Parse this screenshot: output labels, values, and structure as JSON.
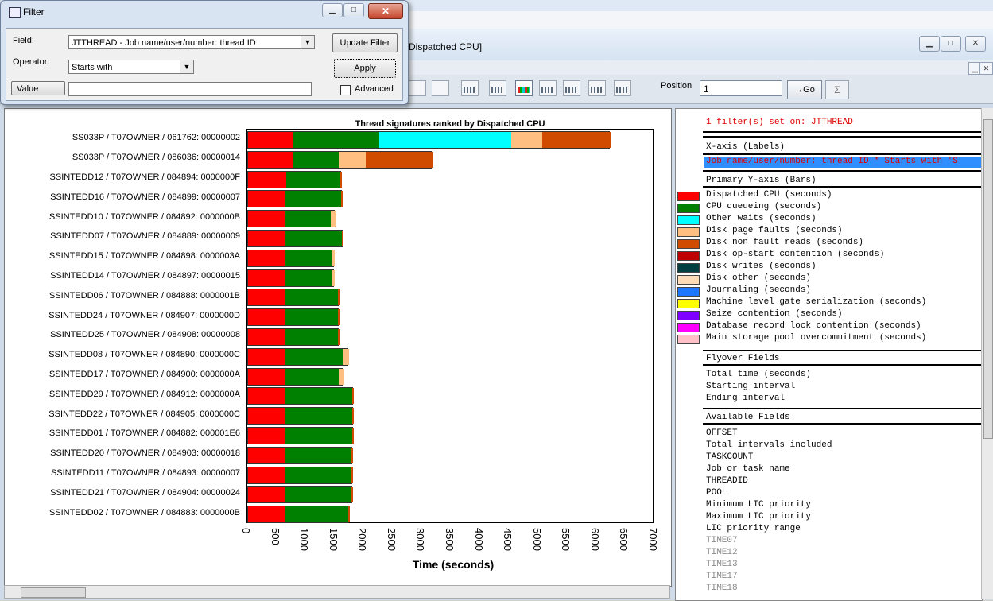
{
  "filter_dialog": {
    "title": "Filter",
    "field_label": "Field:",
    "field_value": "JTTHREAD - Job name/user/number: thread ID",
    "operator_label": "Operator:",
    "operator_value": "Starts with",
    "value_label": "Value",
    "value_input": "",
    "update_filter_label": "Update Filter",
    "apply_label": "Apply",
    "advanced_label": "Advanced",
    "advanced_checked": false
  },
  "main_window": {
    "title": "Dispatched CPU]"
  },
  "toolbar": {
    "position_label": "Position",
    "position_value": "1",
    "go_label": "→Go",
    "sigma_label": "Σ"
  },
  "chart_data": {
    "type": "bar",
    "orientation": "horizontal",
    "stacked": true,
    "title": "Thread signatures ranked by Dispatched CPU",
    "xlabel": "Time (seconds)",
    "ylabel": "",
    "xlim": [
      0,
      7000
    ],
    "xticks": [
      "0",
      "500",
      "1000",
      "1500",
      "2000",
      "2500",
      "3000",
      "3500",
      "4000",
      "4500",
      "5000",
      "5500",
      "6000",
      "6500",
      "7000"
    ],
    "categories": [
      "SS033P / T07OWNER / 061762: 00000002",
      "SS033P / T07OWNER / 086036: 00000014",
      "SSINTEDD12 / T07OWNER / 084894: 0000000F",
      "SSINTEDD16 / T07OWNER / 084899: 00000007",
      "SSINTEDD10 / T07OWNER / 084892: 0000000B",
      "SSINTEDD07 / T07OWNER / 084889: 00000009",
      "SSINTEDD15 / T07OWNER / 084898: 0000003A",
      "SSINTEDD14 / T07OWNER / 084897: 00000015",
      "SSINTEDD06 / T07OWNER / 084888: 0000001B",
      "SSINTEDD24 / T07OWNER / 084907: 0000000D",
      "SSINTEDD25 / T07OWNER / 084908: 00000008",
      "SSINTEDD08 / T07OWNER / 084890: 0000000C",
      "SSINTEDD17 / T07OWNER / 084900: 0000000A",
      "SSINTEDD29 / T07OWNER / 084912: 0000000A",
      "SSINTEDD22 / T07OWNER / 084905: 0000000C",
      "SSINTEDD01 / T07OWNER / 084882: 000001E6",
      "SSINTEDD20 / T07OWNER / 084903: 00000018",
      "SSINTEDD11 / T07OWNER / 084893: 00000007",
      "SSINTEDD21 / T07OWNER / 084904: 00000024",
      "SSINTEDD02 / T07OWNER / 084883: 0000000B"
    ],
    "series": [
      {
        "name": "Dispatched CPU (seconds)",
        "color": "#ff0000",
        "values": [
          780,
          780,
          650,
          640,
          640,
          640,
          640,
          640,
          640,
          640,
          640,
          640,
          640,
          630,
          630,
          630,
          630,
          630,
          630,
          630
        ]
      },
      {
        "name": "CPU queueing (seconds)",
        "color": "#008000",
        "values": [
          1470,
          780,
          930,
          960,
          780,
          970,
          790,
          790,
          910,
          910,
          910,
          1000,
          930,
          1160,
          1160,
          1160,
          1140,
          1140,
          1140,
          1090
        ]
      },
      {
        "name": "Other waits (seconds)",
        "color": "#00ffff",
        "values": [
          2270,
          0,
          0,
          0,
          0,
          0,
          0,
          0,
          0,
          0,
          0,
          0,
          0,
          0,
          0,
          0,
          0,
          0,
          0,
          0
        ]
      },
      {
        "name": "Disk page faults (seconds)",
        "color": "#ffbf80",
        "values": [
          540,
          470,
          0,
          0,
          80,
          0,
          60,
          60,
          0,
          0,
          0,
          90,
          80,
          0,
          0,
          0,
          0,
          0,
          0,
          0
        ]
      },
      {
        "name": "Disk non fault reads (seconds)",
        "color": "#d04a00",
        "values": [
          1180,
          1150,
          30,
          30,
          0,
          30,
          0,
          0,
          30,
          30,
          30,
          0,
          0,
          30,
          30,
          30,
          30,
          30,
          30,
          30
        ]
      },
      {
        "name": "Disk op-start contention (seconds)",
        "color": "#c00000",
        "values": []
      },
      {
        "name": "Disk writes (seconds)",
        "color": "#004040",
        "values": []
      },
      {
        "name": "Disk other (seconds)",
        "color": "#ffdcb8",
        "values": []
      },
      {
        "name": "Journaling (seconds)",
        "color": "#1e78ff",
        "values": []
      },
      {
        "name": "Machine level gate serialization (seconds)",
        "color": "#ffff00",
        "values": []
      },
      {
        "name": "Seize contention (seconds)",
        "color": "#8000ff",
        "values": []
      },
      {
        "name": "Database record lock contention (seconds)",
        "color": "#ff00ff",
        "values": []
      },
      {
        "name": "Main storage pool overcommitment (seconds)",
        "color": "#ffc0c8",
        "values": []
      }
    ]
  },
  "side_panel": {
    "filter_status": "1 filter(s) set on: JTTHREAD",
    "xaxis_header": "X-axis (Labels)",
    "xaxis_selected": "Job name/user/number: thread ID  * Starts with 'S",
    "yaxis_header": "Primary Y-axis (Bars)",
    "flyover_header": "Flyover Fields",
    "flyover_fields": [
      "Total time (seconds)",
      "Starting interval",
      "Ending interval"
    ],
    "available_header": "Available Fields",
    "available_fields": [
      "OFFSET",
      "Total intervals included",
      "TASKCOUNT",
      "Job or task name",
      "THREADID",
      "POOL",
      "Minimum LIC priority",
      "Maximum LIC priority",
      "LIC priority range"
    ],
    "available_fields_grey": [
      "TIME07",
      "TIME12",
      "TIME13",
      "TIME17",
      "TIME18"
    ]
  }
}
